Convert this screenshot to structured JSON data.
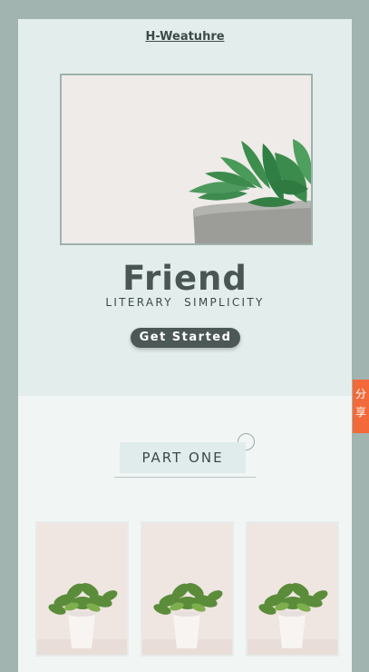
{
  "header": {
    "brand": "H-Weatuhre"
  },
  "hero": {
    "title": "Friend",
    "subtitle": "LITERARY  SIMPLICITY",
    "cta_label": "Get Started"
  },
  "section": {
    "title": "PART ONE"
  },
  "side_tab": {
    "label": "分享"
  },
  "icons": {
    "hero_image": "succulent-plant-image",
    "card_image": "potted-plant-image",
    "ring": "circle-outline-icon"
  },
  "colors": {
    "page_bg": "#a2b4b0",
    "hero_bg": "#e3eeec",
    "section_bg": "#f1f6f5",
    "cta_bg": "#4c5855",
    "side_tab_bg": "#f36a3a"
  }
}
